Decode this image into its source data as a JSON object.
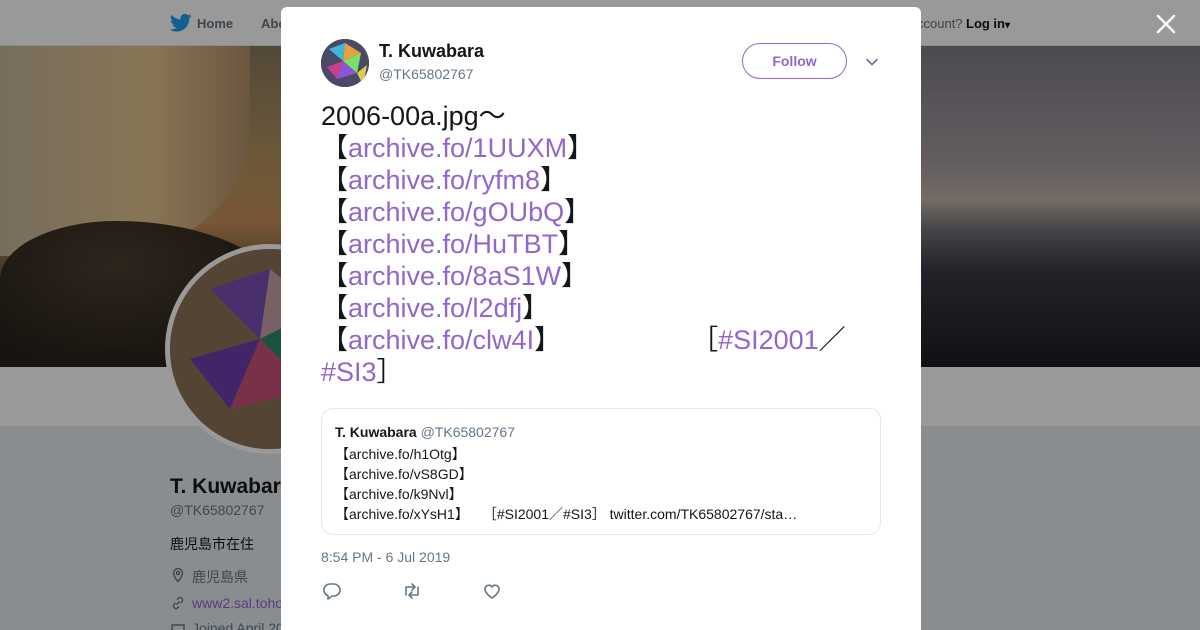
{
  "nav": {
    "home_label": "Home",
    "about_label": "Abo",
    "account_text": "ccount?",
    "login_label": "Log in"
  },
  "profile": {
    "name": "T. Kuwabara",
    "handle": "@TK65802767",
    "bio": "鹿児島市在住",
    "location": "鹿児島県",
    "url": "www2.sal.toho",
    "joined": "Joined April 20"
  },
  "tweet": {
    "author_name": "T. Kuwabara",
    "author_handle": "@TK65802767",
    "follow_label": "Follow",
    "line1": "2006-00a.jpg～",
    "links": [
      "archive.fo/1UUXM",
      "archive.fo/ryfm8",
      "archive.fo/gOUbQ",
      "archive.fo/HuTBT",
      "archive.fo/8aS1W",
      "archive.fo/l2dfj",
      "archive.fo/clw4I"
    ],
    "bracket_open": "【",
    "bracket_close": "】",
    "tag_open": "［",
    "hashtag1": "#SI2001",
    "slash": "／",
    "hashtag2": "#SI3",
    "tag_close": "］",
    "timestamp": "8:54 PM - 6 Jul 2019"
  },
  "quote": {
    "name": "T. Kuwabara",
    "handle": "@TK65802767",
    "lines": [
      "【archive.fo/h1Otg】",
      "【archive.fo/vS8GD】",
      "【archive.fo/k9Nvl】",
      "【archive.fo/xYsH1】　　［#SI2001／#SI3］ twitter.com/TK65802767/sta…"
    ]
  },
  "colors": {
    "accent": "#9266cc",
    "secondary_text": "#657786",
    "primary_text": "#14171a"
  },
  "icons": [
    "twitter-bird-icon",
    "caret-down-icon",
    "close-icon",
    "chevron-down-icon",
    "reply-icon",
    "retweet-icon",
    "like-icon",
    "location-icon",
    "link-icon",
    "calendar-icon"
  ]
}
